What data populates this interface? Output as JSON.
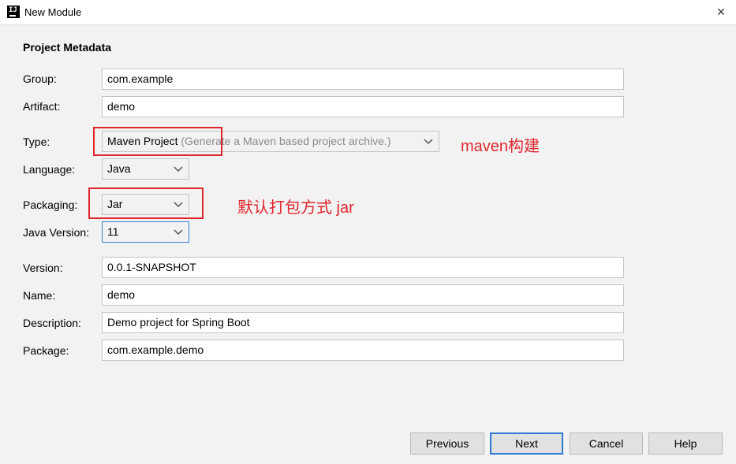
{
  "window": {
    "title": "New Module",
    "close_icon": "×"
  },
  "section_title": "Project Metadata",
  "form": {
    "group": {
      "label": "Group:",
      "value": "com.example"
    },
    "artifact": {
      "label": "Artifact:",
      "value": "demo"
    },
    "type": {
      "label": "Type:",
      "value": "Maven Project",
      "hint": "(Generate a Maven based project archive.)"
    },
    "language": {
      "label": "Language:",
      "value": "Java"
    },
    "packaging": {
      "label": "Packaging:",
      "value": "Jar"
    },
    "java_version": {
      "label": "Java Version:",
      "value": "11"
    },
    "version": {
      "label": "Version:",
      "value": "0.0.1-SNAPSHOT"
    },
    "name": {
      "label": "Name:",
      "value": "demo"
    },
    "description": {
      "label": "Description:",
      "value": "Demo project for Spring Boot"
    },
    "package": {
      "label": "Package:",
      "value": "com.example.demo"
    }
  },
  "annotations": {
    "type_note": "maven构建",
    "packaging_note": "默认打包方式 jar",
    "color": "#e0262d"
  },
  "buttons": {
    "previous": "Previous",
    "next": "Next",
    "cancel": "Cancel",
    "help": "Help"
  }
}
